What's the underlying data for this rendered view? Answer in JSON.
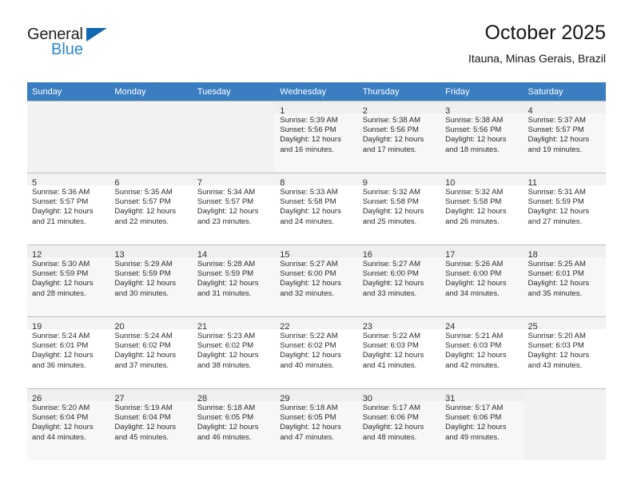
{
  "brand": {
    "name_top": "General",
    "name_bottom": "Blue",
    "accent_color": "#1268b3",
    "accent_color_light": "#2a86d0"
  },
  "header": {
    "title": "October 2025",
    "subtitle": "Itauna, Minas Gerais, Brazil"
  },
  "calendar": {
    "header_bg": "#3a7dc0",
    "weekdays": [
      "Sunday",
      "Monday",
      "Tuesday",
      "Wednesday",
      "Thursday",
      "Friday",
      "Saturday"
    ],
    "labels": {
      "sunrise": "Sunrise:",
      "sunset": "Sunset:",
      "daylight": "Daylight:"
    },
    "weeks": [
      [
        {
          "day": ""
        },
        {
          "day": ""
        },
        {
          "day": ""
        },
        {
          "day": "1",
          "sunrise": "Sunrise: 5:39 AM",
          "sunset": "Sunset: 5:56 PM",
          "daylight_1": "Daylight: 12 hours",
          "daylight_2": "and 16 minutes."
        },
        {
          "day": "2",
          "sunrise": "Sunrise: 5:38 AM",
          "sunset": "Sunset: 5:56 PM",
          "daylight_1": "Daylight: 12 hours",
          "daylight_2": "and 17 minutes."
        },
        {
          "day": "3",
          "sunrise": "Sunrise: 5:38 AM",
          "sunset": "Sunset: 5:56 PM",
          "daylight_1": "Daylight: 12 hours",
          "daylight_2": "and 18 minutes."
        },
        {
          "day": "4",
          "sunrise": "Sunrise: 5:37 AM",
          "sunset": "Sunset: 5:57 PM",
          "daylight_1": "Daylight: 12 hours",
          "daylight_2": "and 19 minutes."
        }
      ],
      [
        {
          "day": "5",
          "sunrise": "Sunrise: 5:36 AM",
          "sunset": "Sunset: 5:57 PM",
          "daylight_1": "Daylight: 12 hours",
          "daylight_2": "and 21 minutes."
        },
        {
          "day": "6",
          "sunrise": "Sunrise: 5:35 AM",
          "sunset": "Sunset: 5:57 PM",
          "daylight_1": "Daylight: 12 hours",
          "daylight_2": "and 22 minutes."
        },
        {
          "day": "7",
          "sunrise": "Sunrise: 5:34 AM",
          "sunset": "Sunset: 5:57 PM",
          "daylight_1": "Daylight: 12 hours",
          "daylight_2": "and 23 minutes."
        },
        {
          "day": "8",
          "sunrise": "Sunrise: 5:33 AM",
          "sunset": "Sunset: 5:58 PM",
          "daylight_1": "Daylight: 12 hours",
          "daylight_2": "and 24 minutes."
        },
        {
          "day": "9",
          "sunrise": "Sunrise: 5:32 AM",
          "sunset": "Sunset: 5:58 PM",
          "daylight_1": "Daylight: 12 hours",
          "daylight_2": "and 25 minutes."
        },
        {
          "day": "10",
          "sunrise": "Sunrise: 5:32 AM",
          "sunset": "Sunset: 5:58 PM",
          "daylight_1": "Daylight: 12 hours",
          "daylight_2": "and 26 minutes."
        },
        {
          "day": "11",
          "sunrise": "Sunrise: 5:31 AM",
          "sunset": "Sunset: 5:59 PM",
          "daylight_1": "Daylight: 12 hours",
          "daylight_2": "and 27 minutes."
        }
      ],
      [
        {
          "day": "12",
          "sunrise": "Sunrise: 5:30 AM",
          "sunset": "Sunset: 5:59 PM",
          "daylight_1": "Daylight: 12 hours",
          "daylight_2": "and 28 minutes."
        },
        {
          "day": "13",
          "sunrise": "Sunrise: 5:29 AM",
          "sunset": "Sunset: 5:59 PM",
          "daylight_1": "Daylight: 12 hours",
          "daylight_2": "and 30 minutes."
        },
        {
          "day": "14",
          "sunrise": "Sunrise: 5:28 AM",
          "sunset": "Sunset: 5:59 PM",
          "daylight_1": "Daylight: 12 hours",
          "daylight_2": "and 31 minutes."
        },
        {
          "day": "15",
          "sunrise": "Sunrise: 5:27 AM",
          "sunset": "Sunset: 6:00 PM",
          "daylight_1": "Daylight: 12 hours",
          "daylight_2": "and 32 minutes."
        },
        {
          "day": "16",
          "sunrise": "Sunrise: 5:27 AM",
          "sunset": "Sunset: 6:00 PM",
          "daylight_1": "Daylight: 12 hours",
          "daylight_2": "and 33 minutes."
        },
        {
          "day": "17",
          "sunrise": "Sunrise: 5:26 AM",
          "sunset": "Sunset: 6:00 PM",
          "daylight_1": "Daylight: 12 hours",
          "daylight_2": "and 34 minutes."
        },
        {
          "day": "18",
          "sunrise": "Sunrise: 5:25 AM",
          "sunset": "Sunset: 6:01 PM",
          "daylight_1": "Daylight: 12 hours",
          "daylight_2": "and 35 minutes."
        }
      ],
      [
        {
          "day": "19",
          "sunrise": "Sunrise: 5:24 AM",
          "sunset": "Sunset: 6:01 PM",
          "daylight_1": "Daylight: 12 hours",
          "daylight_2": "and 36 minutes."
        },
        {
          "day": "20",
          "sunrise": "Sunrise: 5:24 AM",
          "sunset": "Sunset: 6:02 PM",
          "daylight_1": "Daylight: 12 hours",
          "daylight_2": "and 37 minutes."
        },
        {
          "day": "21",
          "sunrise": "Sunrise: 5:23 AM",
          "sunset": "Sunset: 6:02 PM",
          "daylight_1": "Daylight: 12 hours",
          "daylight_2": "and 38 minutes."
        },
        {
          "day": "22",
          "sunrise": "Sunrise: 5:22 AM",
          "sunset": "Sunset: 6:02 PM",
          "daylight_1": "Daylight: 12 hours",
          "daylight_2": "and 40 minutes."
        },
        {
          "day": "23",
          "sunrise": "Sunrise: 5:22 AM",
          "sunset": "Sunset: 6:03 PM",
          "daylight_1": "Daylight: 12 hours",
          "daylight_2": "and 41 minutes."
        },
        {
          "day": "24",
          "sunrise": "Sunrise: 5:21 AM",
          "sunset": "Sunset: 6:03 PM",
          "daylight_1": "Daylight: 12 hours",
          "daylight_2": "and 42 minutes."
        },
        {
          "day": "25",
          "sunrise": "Sunrise: 5:20 AM",
          "sunset": "Sunset: 6:03 PM",
          "daylight_1": "Daylight: 12 hours",
          "daylight_2": "and 43 minutes."
        }
      ],
      [
        {
          "day": "26",
          "sunrise": "Sunrise: 5:20 AM",
          "sunset": "Sunset: 6:04 PM",
          "daylight_1": "Daylight: 12 hours",
          "daylight_2": "and 44 minutes."
        },
        {
          "day": "27",
          "sunrise": "Sunrise: 5:19 AM",
          "sunset": "Sunset: 6:04 PM",
          "daylight_1": "Daylight: 12 hours",
          "daylight_2": "and 45 minutes."
        },
        {
          "day": "28",
          "sunrise": "Sunrise: 5:18 AM",
          "sunset": "Sunset: 6:05 PM",
          "daylight_1": "Daylight: 12 hours",
          "daylight_2": "and 46 minutes."
        },
        {
          "day": "29",
          "sunrise": "Sunrise: 5:18 AM",
          "sunset": "Sunset: 6:05 PM",
          "daylight_1": "Daylight: 12 hours",
          "daylight_2": "and 47 minutes."
        },
        {
          "day": "30",
          "sunrise": "Sunrise: 5:17 AM",
          "sunset": "Sunset: 6:06 PM",
          "daylight_1": "Daylight: 12 hours",
          "daylight_2": "and 48 minutes."
        },
        {
          "day": "31",
          "sunrise": "Sunrise: 5:17 AM",
          "sunset": "Sunset: 6:06 PM",
          "daylight_1": "Daylight: 12 hours",
          "daylight_2": "and 49 minutes."
        },
        {
          "day": ""
        }
      ]
    ]
  }
}
